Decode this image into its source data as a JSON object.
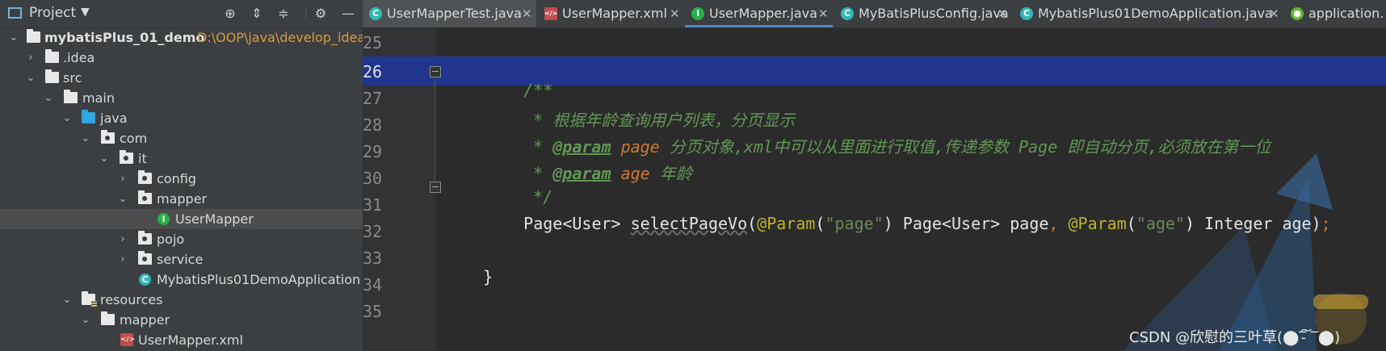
{
  "project_panel": {
    "title": "Project",
    "toolbar_icons": [
      "target-icon",
      "expand-all-icon",
      "collapse-all-icon",
      "gear-icon",
      "minimize-icon"
    ],
    "tree": [
      {
        "label": "mybatisPlus_01_demo",
        "path": "D:\\OOP\\java\\develop_idea\\",
        "icon": "module-folder-icon",
        "expanded": true
      },
      {
        "label": ".idea",
        "icon": "folder-icon",
        "expanded": false
      },
      {
        "label": "src",
        "icon": "folder-icon",
        "expanded": true
      },
      {
        "label": "main",
        "icon": "folder-icon",
        "expanded": true
      },
      {
        "label": "java",
        "icon": "source-folder-icon",
        "expanded": true
      },
      {
        "label": "com",
        "icon": "package-icon",
        "expanded": true
      },
      {
        "label": "it",
        "icon": "package-icon",
        "expanded": true
      },
      {
        "label": "config",
        "icon": "package-icon",
        "expanded": false
      },
      {
        "label": "mapper",
        "icon": "package-icon",
        "expanded": true
      },
      {
        "label": "UserMapper",
        "icon": "interface-icon",
        "selected": true
      },
      {
        "label": "pojo",
        "icon": "package-icon",
        "expanded": false
      },
      {
        "label": "service",
        "icon": "package-icon",
        "expanded": false
      },
      {
        "label": "MybatisPlus01DemoApplication",
        "icon": "spring-class-icon"
      },
      {
        "label": "resources",
        "icon": "resources-folder-icon",
        "expanded": true
      },
      {
        "label": "mapper",
        "icon": "folder-icon",
        "expanded": true
      },
      {
        "label": "UserMapper.xml",
        "icon": "xml-file-icon"
      }
    ]
  },
  "tabs": [
    {
      "label": "UserMapperTest.java",
      "icon": "class-icon"
    },
    {
      "label": "UserMapper.xml",
      "icon": "xml-file-icon"
    },
    {
      "label": "UserMapper.java",
      "icon": "interface-icon",
      "active": true
    },
    {
      "label": "MyBatisPlusConfig.java",
      "icon": "class-icon"
    },
    {
      "label": "MybatisPlus01DemoApplication.java",
      "icon": "spring-class-icon"
    },
    {
      "label": "application.",
      "icon": "spring-config-icon"
    }
  ],
  "editor": {
    "current_line": "26",
    "line_numbers": [
      "25",
      "26",
      "27",
      "28",
      "29",
      "30",
      "31",
      "32",
      "33",
      "34",
      "35"
    ],
    "code": {
      "l26": "/**",
      "l27": "* 根据年龄查询用户列表，分页显示",
      "l28_star": "* ",
      "l28_tag": "@param",
      "l28_name": "page",
      "l28_desc": " 分页对象,xml中可以从里面进行取值,传递参数 Page 即自动分页,必须放在第一位",
      "l29_star": "* ",
      "l29_tag": "@param",
      "l29_name": "age",
      "l29_desc": " 年龄",
      "l30": "*/",
      "l31_type": "Page<User> ",
      "l31_method": "selectPageVo",
      "l31_p1": "(",
      "l31_ann1": "@Param",
      "l31_p2": "(",
      "l31_str1": "\"page\"",
      "l31_p3": ") Page<User> page",
      "l31_comma": ", ",
      "l31_ann2": "@Param",
      "l31_p4": "(",
      "l31_str2": "\"age\"",
      "l31_p5": ") Integer age)",
      "l31_semi": ";",
      "l33": "}"
    }
  },
  "watermark": "CSDN @欣慰的三叶草(⬤‾̵͠ ‾⬤)",
  "colors": {
    "selection_line": "#21358f",
    "comment": "#629755",
    "annotation": "#bbb529",
    "string": "#6a8759",
    "keyword": "#cc7832"
  }
}
